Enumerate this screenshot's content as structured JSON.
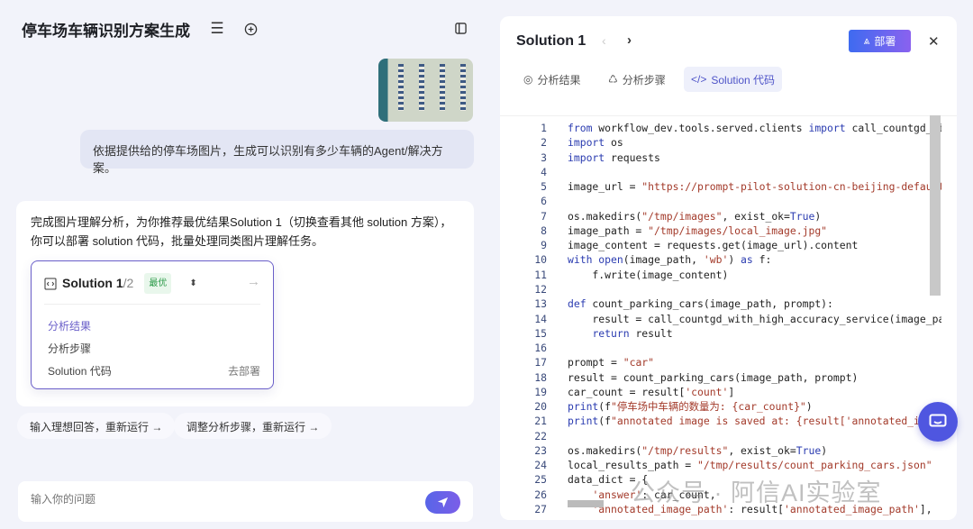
{
  "left": {
    "title": "停车场车辆识别方案生成",
    "user_message": "依据提供给的停车场图片，生成可以识别有多少车辆的Agent/解决方案。",
    "reply_text": "完成图片理解分析，为你推荐最优结果Solution 1（切换查看其他 solution 方案），你可以部署 solution 代码，批量处理同类图片理解任务。",
    "solution_card": {
      "title": "Solution 1",
      "count": "/2",
      "badge": "最优",
      "items": [
        "分析结果",
        "分析步骤",
        "Solution 代码"
      ],
      "deploy_link": "去部署"
    },
    "chips": [
      "输入理想回答，重新运行 →",
      "调整分析步骤，重新运行 →"
    ],
    "input_placeholder": "输入你的问题"
  },
  "panel": {
    "title": "Solution 1",
    "deploy_label": "部署",
    "tabs": [
      "分析结果",
      "分析步骤",
      "Solution 代码"
    ],
    "active_tab": 2,
    "code": [
      [
        [
          "k",
          "from"
        ],
        [
          "p",
          " workflow_dev.tools.served.clients "
        ],
        [
          "k",
          "import"
        ],
        [
          "p",
          " call_countgd_with_high_accuracy_service"
        ]
      ],
      [
        [
          "k",
          "import"
        ],
        [
          "p",
          " os"
        ]
      ],
      [
        [
          "k",
          "import"
        ],
        [
          "p",
          " requests"
        ]
      ],
      [],
      [
        [
          "p",
          "image_url = "
        ],
        [
          "s",
          "\"https://prompt-pilot-solution-cn-beijing-default.tos"
        ]
      ],
      [],
      [
        [
          "p",
          "os.makedirs("
        ],
        [
          "s",
          "\"/tmp/images\""
        ],
        [
          "p",
          ", exist_ok="
        ],
        [
          "k",
          "True"
        ],
        [
          "p",
          ")"
        ]
      ],
      [
        [
          "p",
          "image_path = "
        ],
        [
          "s",
          "\"/tmp/images/local_image.jpg\""
        ]
      ],
      [
        [
          "p",
          "image_content = requests.get(image_url).content"
        ]
      ],
      [
        [
          "k",
          "with"
        ],
        [
          "p",
          " "
        ],
        [
          "b",
          "open"
        ],
        [
          "p",
          "(image_path, "
        ],
        [
          "s",
          "'wb'"
        ],
        [
          "p",
          ") "
        ],
        [
          "k",
          "as"
        ],
        [
          "p",
          " f:"
        ]
      ],
      [
        [
          "p",
          "    f.write(image_content)"
        ]
      ],
      [],
      [
        [
          "k",
          "def"
        ],
        [
          "p",
          " count_parking_cars(image_path, prompt):"
        ]
      ],
      [
        [
          "p",
          "    result = call_countgd_with_high_accuracy_service(image_path, prompt)"
        ]
      ],
      [
        [
          "p",
          "    "
        ],
        [
          "k",
          "return"
        ],
        [
          "p",
          " result"
        ]
      ],
      [],
      [
        [
          "p",
          "prompt = "
        ],
        [
          "s",
          "\"car\""
        ]
      ],
      [
        [
          "p",
          "result = count_parking_cars(image_path, prompt)"
        ]
      ],
      [
        [
          "p",
          "car_count = result["
        ],
        [
          "s",
          "'count'"
        ],
        [
          "p",
          "]"
        ]
      ],
      [
        [
          "b",
          "print"
        ],
        [
          "p",
          "(f"
        ],
        [
          "s",
          "\"停车场中车辆的数量为: {car_count}\""
        ],
        [
          "p",
          ")"
        ]
      ],
      [
        [
          "b",
          "print"
        ],
        [
          "p",
          "(f"
        ],
        [
          "s",
          "\"annotated image is saved at: {result['annotated_image_path']}\""
        ],
        [
          "p",
          ")"
        ]
      ],
      [],
      [
        [
          "p",
          "os.makedirs("
        ],
        [
          "s",
          "\"/tmp/results\""
        ],
        [
          "p",
          ", exist_ok="
        ],
        [
          "k",
          "True"
        ],
        [
          "p",
          ")"
        ]
      ],
      [
        [
          "p",
          "local_results_path = "
        ],
        [
          "s",
          "\"/tmp/results/count_parking_cars.json\""
        ]
      ],
      [
        [
          "p",
          "data_dict = {"
        ]
      ],
      [
        [
          "p",
          "    "
        ],
        [
          "s",
          "'answer'"
        ],
        [
          "p",
          ": car_count,"
        ]
      ],
      [
        [
          "p",
          "    "
        ],
        [
          "s",
          "'annotated_image_path'"
        ],
        [
          "p",
          ": result["
        ],
        [
          "s",
          "'annotated_image_path'"
        ],
        [
          "p",
          "],"
        ]
      ]
    ]
  },
  "watermark": "公众号 · 阿信AI实验室",
  "colors": {
    "accent": "#4f56e0",
    "card_border": "#6a5fc9",
    "badge_green": "#2b9a48"
  }
}
